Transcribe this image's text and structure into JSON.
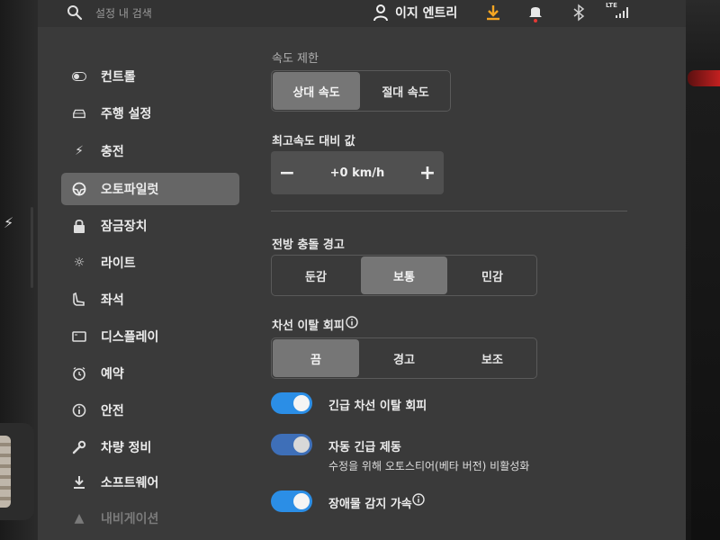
{
  "topbar": {
    "search_placeholder": "설정 내 검색",
    "user_name": "이지 엔트리",
    "network_label": "LTE",
    "icons": [
      "search-icon",
      "user-icon",
      "download-icon",
      "bell-icon",
      "bluetooth-icon",
      "signal-icon"
    ],
    "accent_download": "#f5a623",
    "notification_dot": "#e53935"
  },
  "sidebar": {
    "items": [
      {
        "label": "컨트롤",
        "icon": "toggle-icon"
      },
      {
        "label": "주행 설정",
        "icon": "car-icon"
      },
      {
        "label": "충전",
        "icon": "bolt-icon"
      },
      {
        "label": "오토파일럿",
        "icon": "steering-wheel-icon",
        "active": true
      },
      {
        "label": "잠금장치",
        "icon": "lock-icon"
      },
      {
        "label": "라이트",
        "icon": "light-icon"
      },
      {
        "label": "좌석",
        "icon": "seat-icon"
      },
      {
        "label": "디스플레이",
        "icon": "display-icon"
      },
      {
        "label": "예약",
        "icon": "alarm-clock-icon"
      },
      {
        "label": "안전",
        "icon": "info-circle-icon"
      },
      {
        "label": "차량 정비",
        "icon": "wrench-icon"
      },
      {
        "label": "소프트웨어",
        "icon": "download-icon"
      },
      {
        "label": "내비게이션",
        "icon": "navigation-icon"
      }
    ]
  },
  "speed_limit": {
    "label": "속도 제한",
    "options": [
      "상대 속도",
      "절대 속도"
    ],
    "selected": "상대 속도"
  },
  "speed_offset": {
    "label": "최고속도 대비 값",
    "value": "+0 km/h",
    "minus": "−",
    "plus": "+"
  },
  "forward_collision": {
    "label": "전방 충돌 경고",
    "options": [
      "둔감",
      "보통",
      "민감"
    ],
    "selected": "보통"
  },
  "lane_departure": {
    "label": "차선 이탈 회피",
    "options": [
      "끔",
      "경고",
      "보조"
    ],
    "selected": "끔"
  },
  "toggles": [
    {
      "label": "긴급 차선 이탈 회피",
      "on": true
    },
    {
      "label": "자동 긴급 제동",
      "sub": "수정을 위해 오토스티어(베타 버전) 비활성화",
      "on": true
    },
    {
      "label": "장애물 감지 가속",
      "on": true
    }
  ],
  "colors": {
    "toggle_on": "#2b8ee6",
    "selected_segment": "#767676",
    "active_nav": "#666666"
  }
}
